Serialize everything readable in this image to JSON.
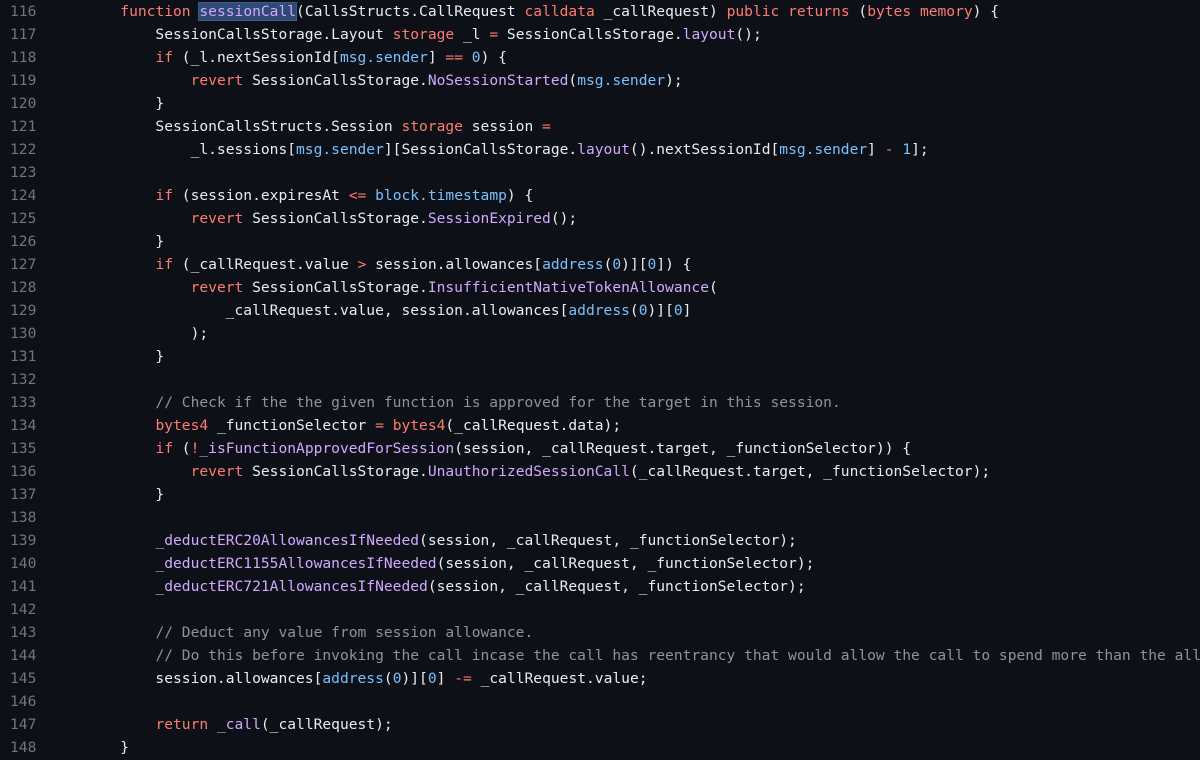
{
  "editor": {
    "lines": [
      {
        "n": "116",
        "tokens": [
          [
            "default",
            "        "
          ],
          [
            "kw",
            "function"
          ],
          [
            "default",
            " "
          ],
          [
            "sel",
            "sessionCall"
          ],
          [
            "default",
            "(CallsStructs.CallRequest "
          ],
          [
            "kw",
            "calldata"
          ],
          [
            "default",
            " _callRequest) "
          ],
          [
            "kw",
            "public"
          ],
          [
            "default",
            " "
          ],
          [
            "kw",
            "returns"
          ],
          [
            "default",
            " ("
          ],
          [
            "kw",
            "bytes"
          ],
          [
            "default",
            " "
          ],
          [
            "kw",
            "memory"
          ],
          [
            "default",
            ") {"
          ]
        ]
      },
      {
        "n": "117",
        "tokens": [
          [
            "default",
            "            SessionCallsStorage.Layout "
          ],
          [
            "kw",
            "storage"
          ],
          [
            "default",
            " _l "
          ],
          [
            "op",
            "="
          ],
          [
            "default",
            " SessionCallsStorage."
          ],
          [
            "fn",
            "layout"
          ],
          [
            "default",
            "();"
          ]
        ]
      },
      {
        "n": "118",
        "tokens": [
          [
            "default",
            "            "
          ],
          [
            "kw",
            "if"
          ],
          [
            "default",
            " (_l.nextSessionId["
          ],
          [
            "prop",
            "msg.sender"
          ],
          [
            "default",
            "] "
          ],
          [
            "op",
            "=="
          ],
          [
            "default",
            " "
          ],
          [
            "num",
            "0"
          ],
          [
            "default",
            ") {"
          ]
        ]
      },
      {
        "n": "119",
        "tokens": [
          [
            "default",
            "                "
          ],
          [
            "kw",
            "revert"
          ],
          [
            "default",
            " SessionCallsStorage."
          ],
          [
            "fn",
            "NoSessionStarted"
          ],
          [
            "default",
            "("
          ],
          [
            "prop",
            "msg.sender"
          ],
          [
            "default",
            ");"
          ]
        ]
      },
      {
        "n": "120",
        "tokens": [
          [
            "default",
            "            }"
          ]
        ]
      },
      {
        "n": "121",
        "tokens": [
          [
            "default",
            "            SessionCallsStructs.Session "
          ],
          [
            "kw",
            "storage"
          ],
          [
            "default",
            " session "
          ],
          [
            "op",
            "="
          ]
        ]
      },
      {
        "n": "122",
        "tokens": [
          [
            "default",
            "                _l.sessions["
          ],
          [
            "prop",
            "msg.sender"
          ],
          [
            "default",
            "][SessionCallsStorage."
          ],
          [
            "fn",
            "layout"
          ],
          [
            "default",
            "().nextSessionId["
          ],
          [
            "prop",
            "msg.sender"
          ],
          [
            "default",
            "] "
          ],
          [
            "op",
            "-"
          ],
          [
            "default",
            " "
          ],
          [
            "num",
            "1"
          ],
          [
            "default",
            "];"
          ]
        ]
      },
      {
        "n": "123",
        "tokens": []
      },
      {
        "n": "124",
        "tokens": [
          [
            "default",
            "            "
          ],
          [
            "kw",
            "if"
          ],
          [
            "default",
            " (session.expiresAt "
          ],
          [
            "op",
            "<="
          ],
          [
            "default",
            " "
          ],
          [
            "prop",
            "block.timestamp"
          ],
          [
            "default",
            ") {"
          ]
        ]
      },
      {
        "n": "125",
        "tokens": [
          [
            "default",
            "                "
          ],
          [
            "kw",
            "revert"
          ],
          [
            "default",
            " SessionCallsStorage."
          ],
          [
            "fn",
            "SessionExpired"
          ],
          [
            "default",
            "();"
          ]
        ]
      },
      {
        "n": "126",
        "tokens": [
          [
            "default",
            "            }"
          ]
        ]
      },
      {
        "n": "127",
        "tokens": [
          [
            "default",
            "            "
          ],
          [
            "kw",
            "if"
          ],
          [
            "default",
            " (_callRequest.value "
          ],
          [
            "op",
            ">"
          ],
          [
            "default",
            " session.allowances["
          ],
          [
            "prop",
            "address"
          ],
          [
            "default",
            "("
          ],
          [
            "num",
            "0"
          ],
          [
            "default",
            ")]["
          ],
          [
            "num",
            "0"
          ],
          [
            "default",
            "]) {"
          ]
        ]
      },
      {
        "n": "128",
        "tokens": [
          [
            "default",
            "                "
          ],
          [
            "kw",
            "revert"
          ],
          [
            "default",
            " SessionCallsStorage."
          ],
          [
            "fn",
            "InsufficientNativeTokenAllowance"
          ],
          [
            "default",
            "("
          ]
        ]
      },
      {
        "n": "129",
        "tokens": [
          [
            "default",
            "                    _callRequest.value, session.allowances["
          ],
          [
            "prop",
            "address"
          ],
          [
            "default",
            "("
          ],
          [
            "num",
            "0"
          ],
          [
            "default",
            ")]["
          ],
          [
            "num",
            "0"
          ],
          [
            "default",
            "]"
          ]
        ]
      },
      {
        "n": "130",
        "tokens": [
          [
            "default",
            "                );"
          ]
        ]
      },
      {
        "n": "131",
        "tokens": [
          [
            "default",
            "            }"
          ]
        ]
      },
      {
        "n": "132",
        "tokens": []
      },
      {
        "n": "133",
        "tokens": [
          [
            "default",
            "            "
          ],
          [
            "comment",
            "// Check if the the given function is approved for the target in this session."
          ]
        ]
      },
      {
        "n": "134",
        "tokens": [
          [
            "default",
            "            "
          ],
          [
            "type",
            "bytes4"
          ],
          [
            "default",
            " _functionSelector "
          ],
          [
            "op",
            "="
          ],
          [
            "default",
            " "
          ],
          [
            "type",
            "bytes4"
          ],
          [
            "default",
            "(_callRequest.data);"
          ]
        ]
      },
      {
        "n": "135",
        "tokens": [
          [
            "default",
            "            "
          ],
          [
            "kw",
            "if"
          ],
          [
            "default",
            " ("
          ],
          [
            "op",
            "!"
          ],
          [
            "fn",
            "_isFunctionApprovedForSession"
          ],
          [
            "default",
            "(session, _callRequest.target, _functionSelector)) {"
          ]
        ]
      },
      {
        "n": "136",
        "tokens": [
          [
            "default",
            "                "
          ],
          [
            "kw",
            "revert"
          ],
          [
            "default",
            " SessionCallsStorage."
          ],
          [
            "fn",
            "UnauthorizedSessionCall"
          ],
          [
            "default",
            "(_callRequest.target, _functionSelector);"
          ]
        ]
      },
      {
        "n": "137",
        "tokens": [
          [
            "default",
            "            }"
          ]
        ]
      },
      {
        "n": "138",
        "tokens": []
      },
      {
        "n": "139",
        "tokens": [
          [
            "default",
            "            "
          ],
          [
            "fn",
            "_deductERC20AllowancesIfNeeded"
          ],
          [
            "default",
            "(session, _callRequest, _functionSelector);"
          ]
        ]
      },
      {
        "n": "140",
        "tokens": [
          [
            "default",
            "            "
          ],
          [
            "fn",
            "_deductERC1155AllowancesIfNeeded"
          ],
          [
            "default",
            "(session, _callRequest, _functionSelector);"
          ]
        ]
      },
      {
        "n": "141",
        "tokens": [
          [
            "default",
            "            "
          ],
          [
            "fn",
            "_deductERC721AllowancesIfNeeded"
          ],
          [
            "default",
            "(session, _callRequest, _functionSelector);"
          ]
        ]
      },
      {
        "n": "142",
        "tokens": []
      },
      {
        "n": "143",
        "tokens": [
          [
            "default",
            "            "
          ],
          [
            "comment",
            "// Deduct any value from session allowance."
          ]
        ]
      },
      {
        "n": "144",
        "tokens": [
          [
            "default",
            "            "
          ],
          [
            "comment",
            "// Do this before invoking the call incase the call has reentrancy that would allow the call to spend more than the allowance."
          ]
        ]
      },
      {
        "n": "145",
        "tokens": [
          [
            "default",
            "            session.allowances["
          ],
          [
            "prop",
            "address"
          ],
          [
            "default",
            "("
          ],
          [
            "num",
            "0"
          ],
          [
            "default",
            ")]["
          ],
          [
            "num",
            "0"
          ],
          [
            "default",
            "] "
          ],
          [
            "op",
            "-="
          ],
          [
            "default",
            " _callRequest.value;"
          ]
        ]
      },
      {
        "n": "146",
        "tokens": []
      },
      {
        "n": "147",
        "tokens": [
          [
            "default",
            "            "
          ],
          [
            "kw",
            "return"
          ],
          [
            "default",
            " "
          ],
          [
            "fn",
            "_call"
          ],
          [
            "default",
            "(_callRequest);"
          ]
        ]
      },
      {
        "n": "148",
        "tokens": [
          [
            "default",
            "        }"
          ]
        ]
      }
    ]
  },
  "colors": {
    "background": "#0d1117",
    "line_number": "#6e7681",
    "keyword": "#ff7b72",
    "function": "#d2a8ff",
    "property": "#79c0ff",
    "comment": "#8b949e",
    "selection": "#2f4a73"
  }
}
